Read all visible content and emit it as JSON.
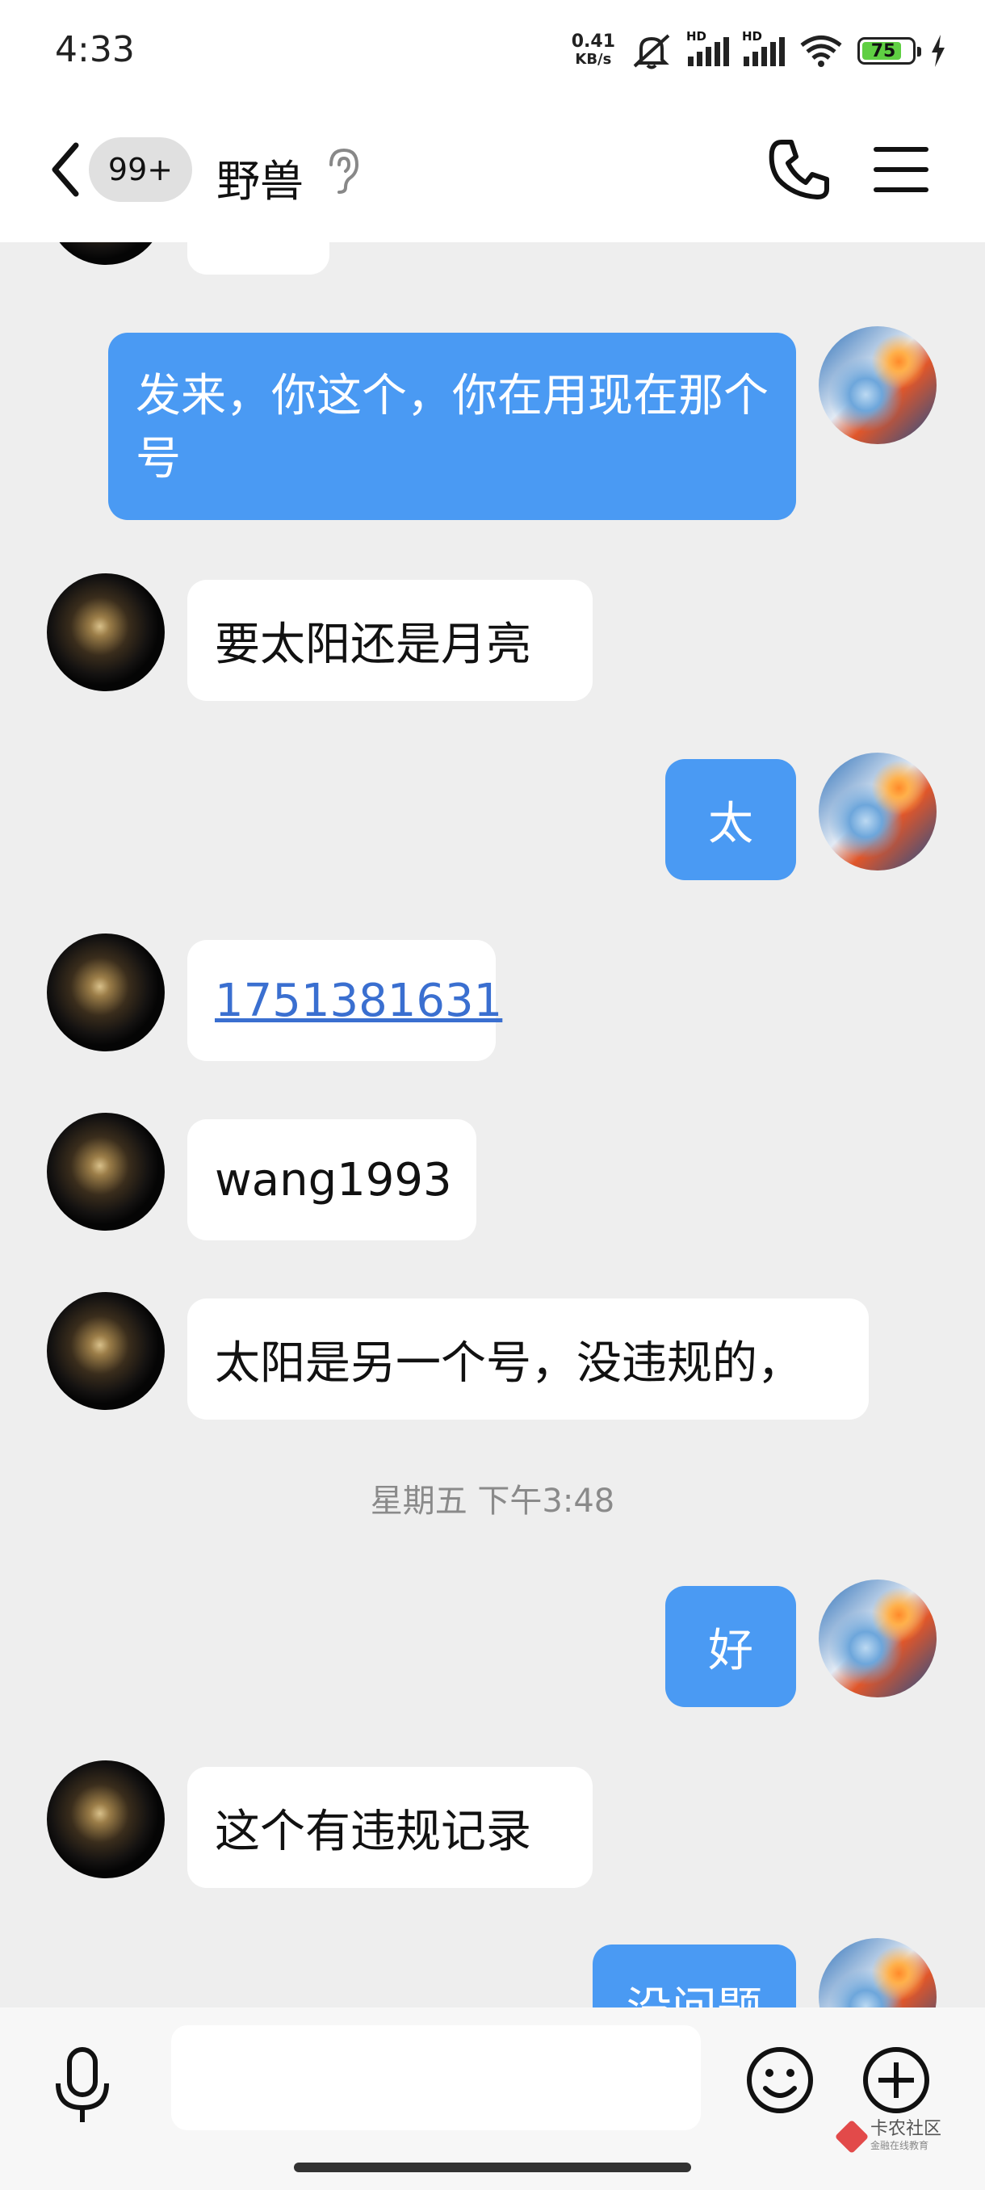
{
  "status_bar": {
    "time": "4:33",
    "net_speed_value": "0.41",
    "net_speed_unit": "KB/s",
    "signal_1_label": "HD",
    "signal_2_label": "HD",
    "battery_level": "75"
  },
  "header": {
    "unread_badge": "99+",
    "contact_name": "野兽"
  },
  "messages": [
    {
      "sender": "me",
      "text": "发来，你这个，你在用现在那个号"
    },
    {
      "sender": "them",
      "text": "要太阳还是月亮"
    },
    {
      "sender": "me",
      "text": "太"
    },
    {
      "sender": "them",
      "text": "1751381631"
    },
    {
      "sender": "them",
      "text": "wang1993"
    },
    {
      "sender": "them",
      "text": "太阳是另一个号，没违规的，"
    },
    {
      "sender": "me",
      "text": "好"
    },
    {
      "sender": "them",
      "text": "这个有违规记录"
    },
    {
      "sender": "me",
      "text": "没问题"
    }
  ],
  "time_divider": "星期五 下午3:48",
  "input": {
    "placeholder": ""
  },
  "watermark": {
    "text": "卡农社区",
    "subtext": "金融在线教育"
  },
  "colors": {
    "my_bubble": "#4a9af3",
    "their_bubble": "#ffffff",
    "chat_background": "#eeeeee",
    "link": "#3a6fd0"
  }
}
